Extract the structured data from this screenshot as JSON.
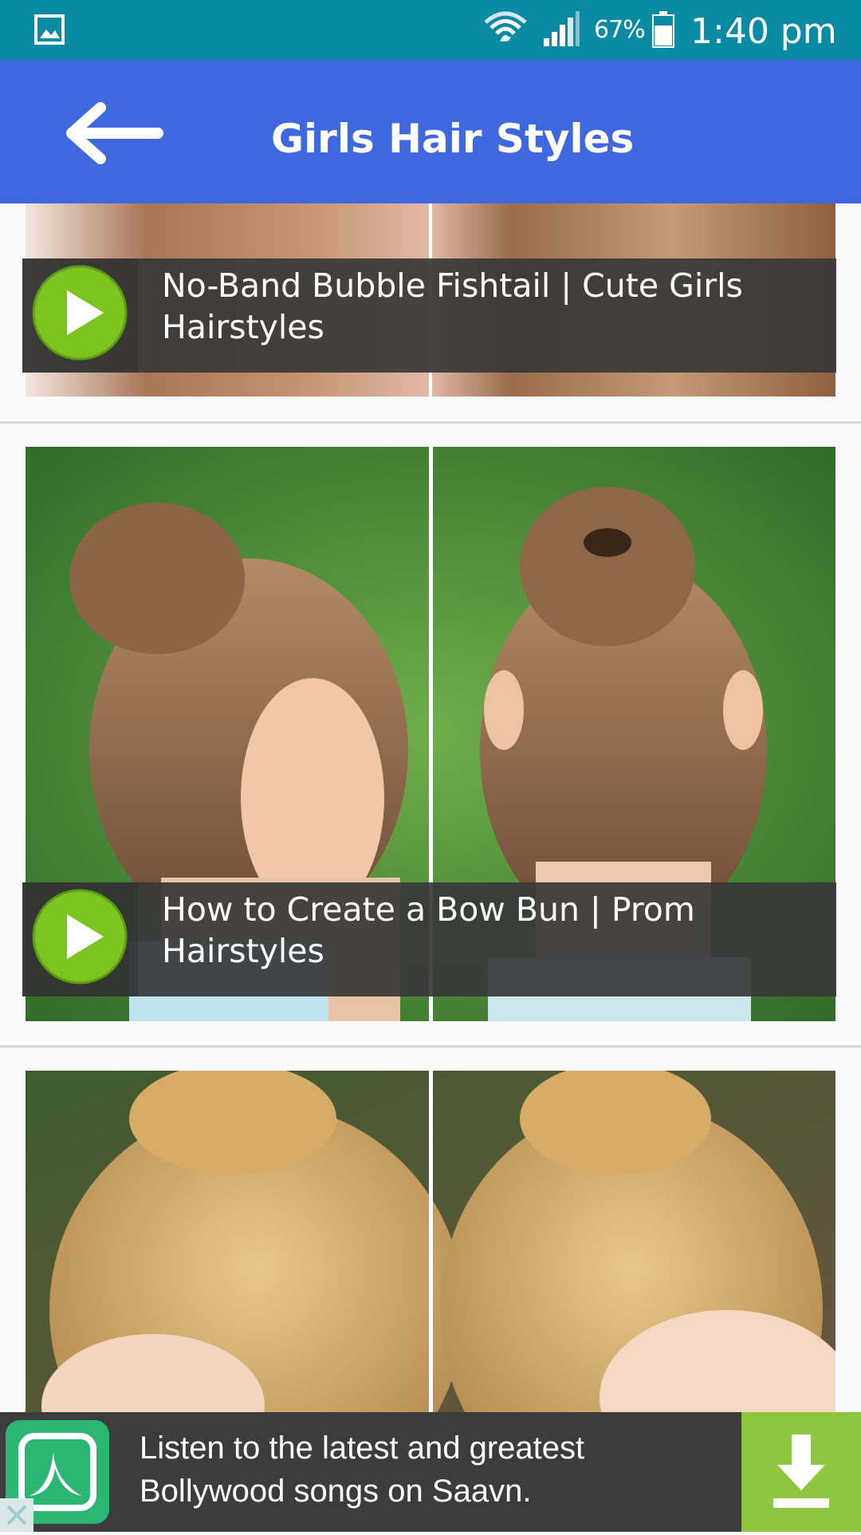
{
  "status_bar": {
    "battery_percent": "67%",
    "time": "1:40 pm"
  },
  "app_bar": {
    "title": "Girls Hair Styles"
  },
  "videos": [
    {
      "title": "No-Band Bubble Fishtail | Cute Girls Hairstyles"
    },
    {
      "title": "How to Create a Bow Bun | Prom Hairstyles"
    },
    {
      "title": ""
    }
  ],
  "ad": {
    "text": "Listen to the latest and greatest Bollywood songs on Saavn."
  },
  "icons": {
    "gallery": "gallery-icon",
    "wifi": "wifi-icon",
    "signal": "signal-icon",
    "battery": "battery-icon",
    "back": "back-arrow-icon",
    "play": "play-icon",
    "download": "download-icon",
    "close": "close-icon"
  },
  "colors": {
    "status_bar": "#0a8aa3",
    "app_bar": "#3f67de",
    "play_button": "#7cc520",
    "ad_download": "#8dc63f"
  }
}
